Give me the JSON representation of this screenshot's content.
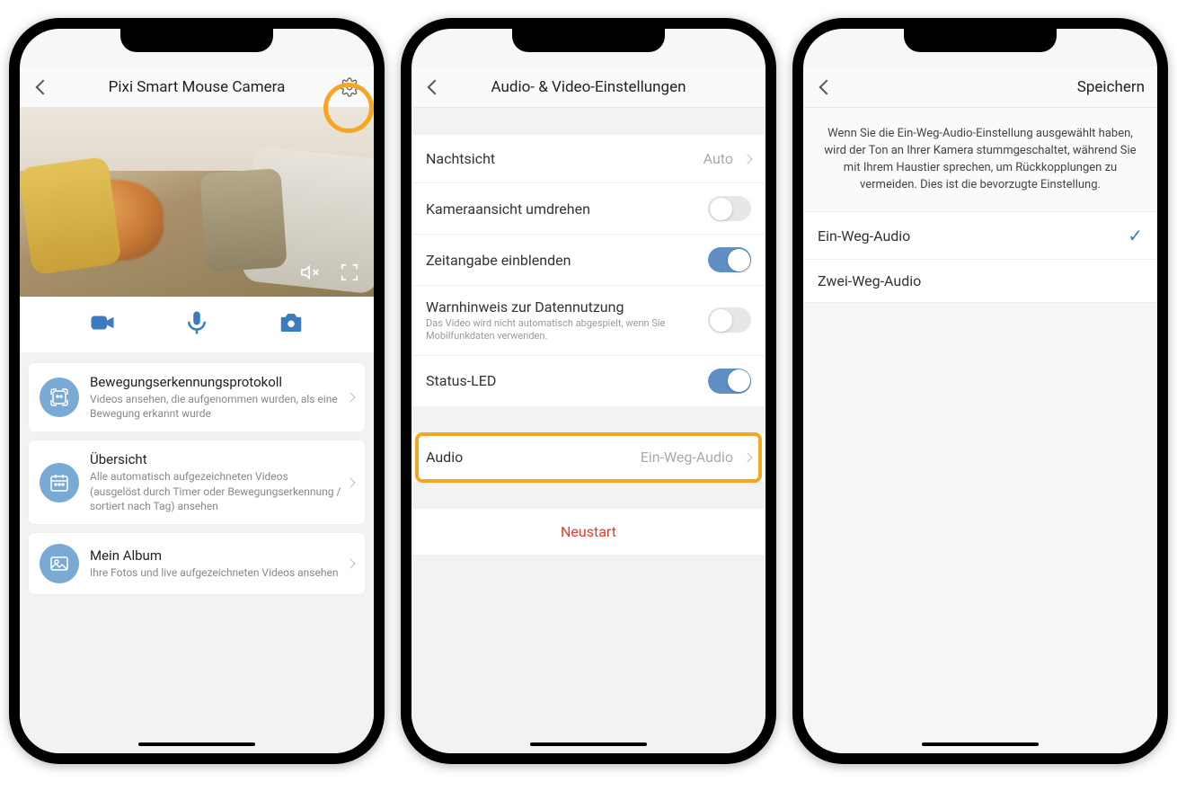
{
  "phone1": {
    "title": "Pixi Smart Mouse Camera",
    "cards": [
      {
        "title": "Bewegungserkennungsprotokoll",
        "sub": "Videos ansehen, die aufgenommen wurden, als eine Bewegung erkannt wurde"
      },
      {
        "title": "Übersicht",
        "sub": "Alle automatisch aufgezeichneten Videos (ausgelöst durch Timer oder Bewegungserkennung / sortiert nach Tag) ansehen"
      },
      {
        "title": "Mein Album",
        "sub": "Ihre Fotos und live aufgezeichneten Videos ansehen"
      }
    ]
  },
  "phone2": {
    "title": "Audio- & Video-Einstellungen",
    "rows": {
      "nightvision": {
        "label": "Nachtsicht",
        "value": "Auto"
      },
      "flip": {
        "label": "Kameraansicht umdrehen"
      },
      "timestamp": {
        "label": "Zeitangabe einblenden"
      },
      "datawarning": {
        "label": "Warnhinweis zur Datennutzung",
        "sub": "Das Video wird nicht automatisch abgespielt, wenn Sie Mobilfunkdaten verwenden."
      },
      "statusled": {
        "label": "Status-LED"
      },
      "audio": {
        "label": "Audio",
        "value": "Ein-Weg-Audio"
      }
    },
    "restart": "Neustart"
  },
  "phone3": {
    "save": "Speichern",
    "info": "Wenn Sie die Ein-Weg-Audio-Einstellung ausgewählt haben, wird der Ton an Ihrer Kamera stummgeschaltet, während Sie mit Ihrem Haustier sprechen, um Rückkopplungen zu vermeiden. Dies ist die bevorzugte Einstellung.",
    "options": {
      "oneway": "Ein-Weg-Audio",
      "twoway": "Zwei-Weg-Audio"
    }
  }
}
